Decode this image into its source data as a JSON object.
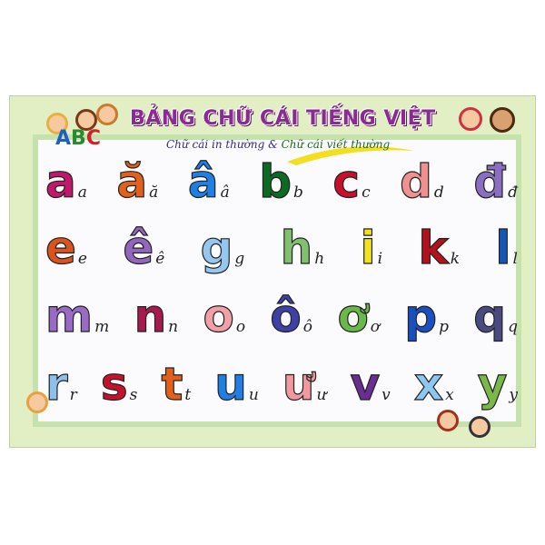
{
  "title": "BẢNG CHỮ CÁI TIẾNG VIỆT",
  "subtitle_part1": "Chữ cái in thường &",
  "subtitle_part2": "Chữ cái viết thường",
  "abc_logo": [
    "A",
    "B",
    "C"
  ],
  "rows": [
    [
      {
        "p": "a",
        "w": "a",
        "c": "#c2186a"
      },
      {
        "p": "ă",
        "w": "ă",
        "c": "#e0601c"
      },
      {
        "p": "â",
        "w": "â",
        "c": "#1e7fe6"
      },
      {
        "p": "b",
        "w": "b",
        "c": "#0b6b22"
      },
      {
        "p": "c",
        "w": "c",
        "c": "#c8102e"
      },
      {
        "p": "d",
        "w": "d",
        "c": "#f09090"
      },
      {
        "p": "đ",
        "w": "đ",
        "c": "#8a6fc0"
      }
    ],
    [
      {
        "p": "e",
        "w": "e",
        "c": "#d9531e"
      },
      {
        "p": "ê",
        "w": "ê",
        "c": "#9366bd"
      },
      {
        "p": "g",
        "w": "g",
        "c": "#95c8f0"
      },
      {
        "p": "h",
        "w": "h",
        "c": "#82c070"
      },
      {
        "p": "i",
        "w": "i",
        "c": "#f2e21a"
      },
      {
        "p": "k",
        "w": "k",
        "c": "#b3111d"
      },
      {
        "p": "l",
        "w": "l",
        "c": "#1457b8"
      }
    ],
    [
      {
        "p": "m",
        "w": "m",
        "c": "#9a6bc4"
      },
      {
        "p": "n",
        "w": "n",
        "c": "#a8194e"
      },
      {
        "p": "o",
        "w": "o",
        "c": "#f2a0a8"
      },
      {
        "p": "ô",
        "w": "ô",
        "c": "#3f3fa8"
      },
      {
        "p": "ơ",
        "w": "ơ",
        "c": "#6ab84a"
      },
      {
        "p": "p",
        "w": "p",
        "c": "#1a4fc0"
      },
      {
        "p": "q",
        "w": "q",
        "c": "#4a4a80"
      }
    ],
    [
      {
        "p": "r",
        "w": "r",
        "c": "#8ec0ea"
      },
      {
        "p": "s",
        "w": "s",
        "c": "#c8102e"
      },
      {
        "p": "t",
        "w": "t",
        "c": "#e0601c"
      },
      {
        "p": "u",
        "w": "u",
        "c": "#1e7fe6"
      },
      {
        "p": "ư",
        "w": "ư",
        "c": "#f09aa0"
      },
      {
        "p": "v",
        "w": "v",
        "c": "#6a2d92"
      },
      {
        "p": "x",
        "w": "x",
        "c": "#8ec8f0"
      },
      {
        "p": "y",
        "w": "y",
        "c": "#7ab84a"
      }
    ]
  ]
}
